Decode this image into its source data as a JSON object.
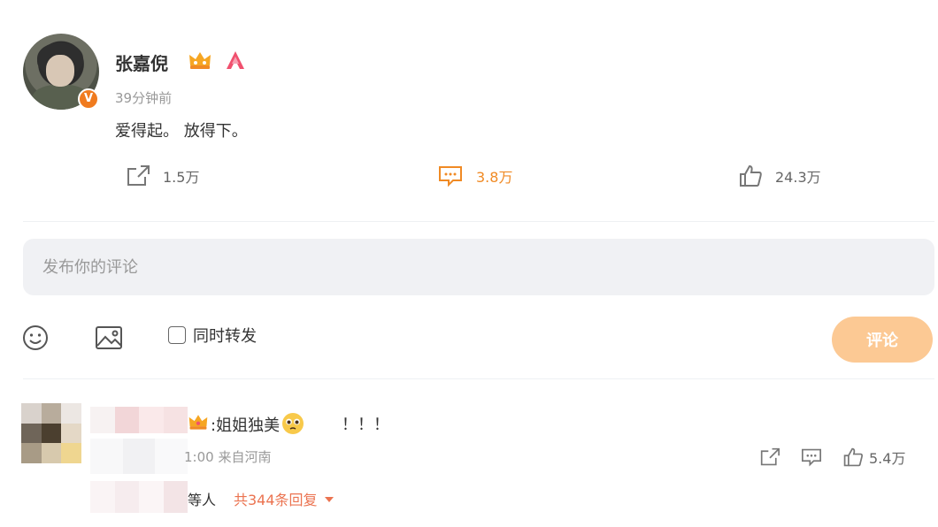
{
  "post": {
    "username": "张嘉倪",
    "timestamp": "39分钟前",
    "text": "爱得起。 放得下。",
    "verified_label": "V",
    "accent_color": "#f08a24"
  },
  "actions": {
    "share_count": "1.5万",
    "comment_count": "3.8万",
    "like_count": "24.3万"
  },
  "composer": {
    "placeholder": "发布你的评论",
    "repost_label": "同时转发",
    "submit_label": "评论"
  },
  "reply": {
    "text": ":姐姐独美",
    "exclaim": "！！！",
    "meta": "1:00 来自河南",
    "like_count": "5.4万",
    "replies_prefix": "等人",
    "replies_link": "共344条回复"
  }
}
